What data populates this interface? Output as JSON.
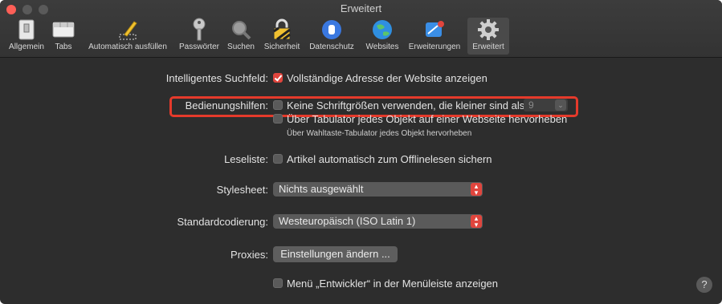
{
  "window": {
    "title": "Erweitert"
  },
  "toolbar": {
    "items": [
      {
        "label": "Allgemein",
        "icon": "switch-icon"
      },
      {
        "label": "Tabs",
        "icon": "tabs-icon"
      },
      {
        "label": "Automatisch ausfüllen",
        "icon": "pencil-icon"
      },
      {
        "label": "Passwörter",
        "icon": "key-icon"
      },
      {
        "label": "Suchen",
        "icon": "magnifier-icon"
      },
      {
        "label": "Sicherheit",
        "icon": "lock-icon"
      },
      {
        "label": "Datenschutz",
        "icon": "hand-icon"
      },
      {
        "label": "Websites",
        "icon": "globe-icon"
      },
      {
        "label": "Erweiterungen",
        "icon": "puzzle-icon"
      },
      {
        "label": "Erweitert",
        "icon": "gear-icon"
      }
    ],
    "active": "Erweitert"
  },
  "settings": {
    "search_field": {
      "label": "Intelligentes Suchfeld:",
      "option": "Vollständige Adresse der Website anzeigen",
      "checked": true
    },
    "accessibility": {
      "label": "Bedienungshilfen:",
      "option1": "Keine Schriftgrößen verwenden, die kleiner sind als",
      "option1_checked": false,
      "min_font_size": "9",
      "option2": "Über Tabulator jedes Objekt auf einer Webseite hervorheben",
      "option2_checked": false,
      "hint": "Über Wahltaste-Tabulator jedes Objekt hervorheben"
    },
    "reading_list": {
      "label": "Leseliste:",
      "option": "Artikel automatisch zum Offlinelesen sichern",
      "checked": false
    },
    "stylesheet": {
      "label": "Stylesheet:",
      "value": "Nichts ausgewählt"
    },
    "encoding": {
      "label": "Standardcodierung:",
      "value": "Westeuropäisch (ISO Latin 1)"
    },
    "proxies": {
      "label": "Proxies:",
      "button": "Einstellungen ändern ..."
    },
    "develop_menu": {
      "option": "Menü „Entwickler“ in der Menüleiste anzeigen",
      "checked": false
    }
  },
  "help": {
    "label": "?"
  },
  "colors": {
    "accent": "#e0453d",
    "highlight": "#e53a2b",
    "background": "#2d2d2d"
  }
}
